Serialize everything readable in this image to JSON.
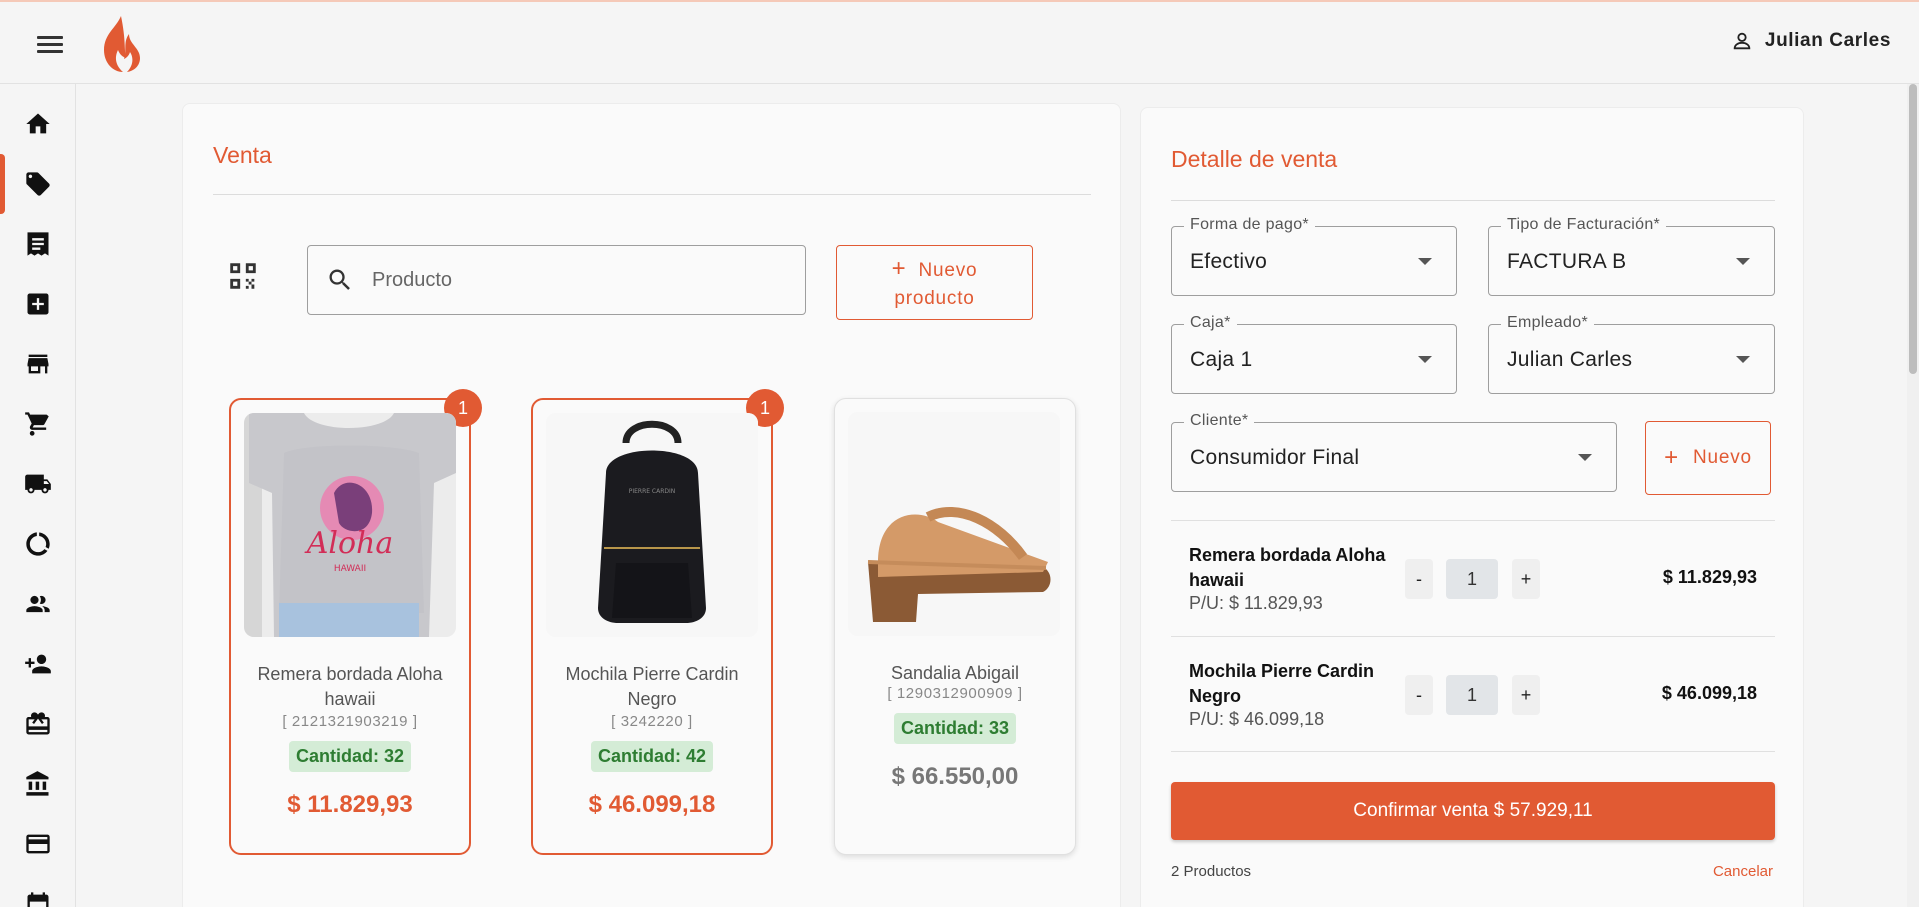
{
  "topbar": {
    "user_name": "Julian Carles"
  },
  "sidebar": {
    "items": [
      {
        "icon": "home-icon",
        "active": false
      },
      {
        "icon": "tag-icon",
        "active": true
      },
      {
        "icon": "receipt-icon",
        "active": false
      },
      {
        "icon": "add-box-icon",
        "active": false
      },
      {
        "icon": "store-icon",
        "active": false
      },
      {
        "icon": "cart-icon",
        "active": false
      },
      {
        "icon": "truck-icon",
        "active": false
      },
      {
        "icon": "donut-chart-icon",
        "active": false
      },
      {
        "icon": "people-icon",
        "active": false
      },
      {
        "icon": "person-add-icon",
        "active": false
      },
      {
        "icon": "gift-card-icon",
        "active": false
      },
      {
        "icon": "bank-icon",
        "active": false
      },
      {
        "icon": "credit-card-icon",
        "active": false
      },
      {
        "icon": "calendar-icon",
        "active": false
      }
    ]
  },
  "venta": {
    "title": "Venta",
    "search_placeholder": "Producto",
    "new_product_line1": "Nuevo",
    "new_product_line2": "producto",
    "products": [
      {
        "name": "Remera bordada Aloha hawaii",
        "code": "[ 2121321903219 ]",
        "qty": "Cantidad: 32",
        "price": "$ 11.829,93",
        "badge": "1",
        "selected": true
      },
      {
        "name": "Mochila Pierre Cardin Negro",
        "code": "[ 3242220 ]",
        "qty": "Cantidad: 42",
        "price": "$ 46.099,18",
        "badge": "1",
        "selected": true
      },
      {
        "name": "Sandalia Abigail",
        "code": "[ 1290312900909 ]",
        "qty": "Cantidad: 33",
        "price": "$ 66.550,00",
        "badge": "",
        "selected": false
      }
    ]
  },
  "detalle": {
    "title": "Detalle de venta",
    "forma_pago": {
      "label": "Forma de pago*",
      "value": "Efectivo"
    },
    "tipo_fact": {
      "label": "Tipo de Facturación*",
      "value": "FACTURA B"
    },
    "caja": {
      "label": "Caja*",
      "value": "Caja 1"
    },
    "empleado": {
      "label": "Empleado*",
      "value": "Julian Carles"
    },
    "cliente": {
      "label": "Cliente*",
      "value": "Consumidor Final"
    },
    "new_client": "Nuevo",
    "items": [
      {
        "name": "Remera bordada Aloha hawaii",
        "pu": "P/U: $ 11.829,93",
        "qty": "1",
        "total": "$ 11.829,93"
      },
      {
        "name": "Mochila Pierre Cardin Negro",
        "pu": "P/U: $ 46.099,18",
        "qty": "1",
        "total": "$ 46.099,18"
      }
    ],
    "minus": "-",
    "plus": "+",
    "confirm": "Confirmar venta $ 57.929,11",
    "count": "2 Productos",
    "cancel": "Cancelar"
  },
  "colors": {
    "accent": "#e15a33",
    "qty_bg": "#d4ecd6",
    "qty_text": "#2e7d32"
  }
}
